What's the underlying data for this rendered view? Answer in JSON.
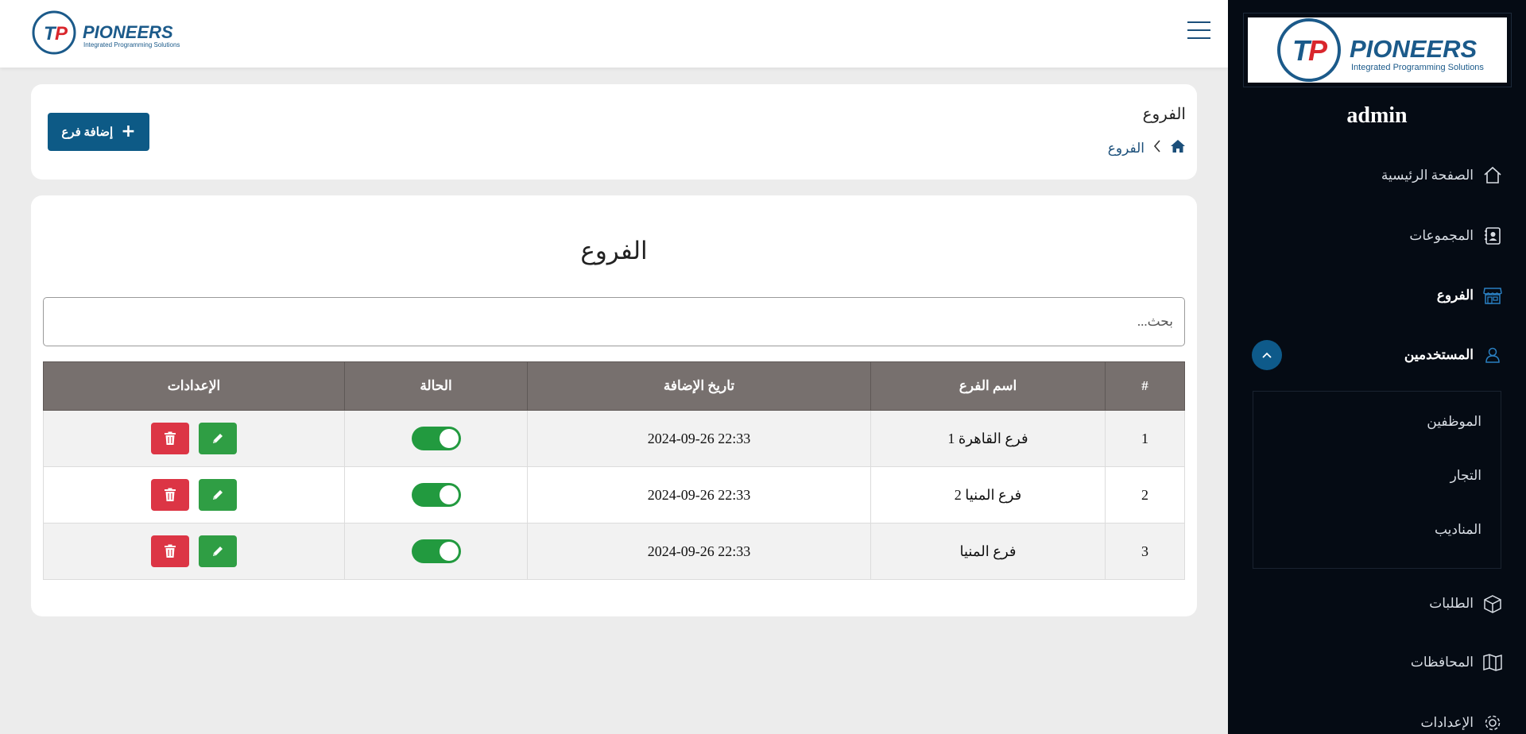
{
  "brand": {
    "name": "PIONEERS",
    "tagline": "Integrated Programming Solutions",
    "accent": "#1b5a8a"
  },
  "sidebar": {
    "username": "admin",
    "items": [
      {
        "label": "الصفحة الرئيسية",
        "icon": "home-icon"
      },
      {
        "label": "المجموعات",
        "icon": "contact-book-icon"
      },
      {
        "label": "الفروع",
        "icon": "shop-icon"
      },
      {
        "label": "المستخدمين",
        "icon": "user-icon"
      },
      {
        "label": "الطلبات",
        "icon": "box-icon"
      },
      {
        "label": "المحافظات",
        "icon": "map-icon"
      },
      {
        "label": "الإعدادات",
        "icon": "gear-icon"
      }
    ],
    "users_submenu": [
      "الموظفين",
      "التجار",
      "المناديب"
    ]
  },
  "header": {
    "title": "الفروع",
    "breadcrumb": "الفروع",
    "add_button": "إضافة فرع"
  },
  "main": {
    "title": "الفروع",
    "search_placeholder": "بحث...",
    "columns": [
      "#",
      "اسم الفرع",
      "تاريخ الإضافة",
      "الحالة",
      "الإعدادات"
    ],
    "rows": [
      {
        "num": "1",
        "name": "فرع القاهرة 1",
        "date": "2024-09-26 22:33",
        "active": true
      },
      {
        "num": "2",
        "name": "فرع المنيا 2",
        "date": "2024-09-26 22:33",
        "active": true
      },
      {
        "num": "3",
        "name": "فرع المنيا",
        "date": "2024-09-26 22:33",
        "active": true
      }
    ]
  },
  "colors": {
    "sidebar_bg": "#050b14",
    "primary": "#0d5a86",
    "success": "#2f9e44",
    "danger": "#dc3545",
    "table_header": "#77706e"
  }
}
